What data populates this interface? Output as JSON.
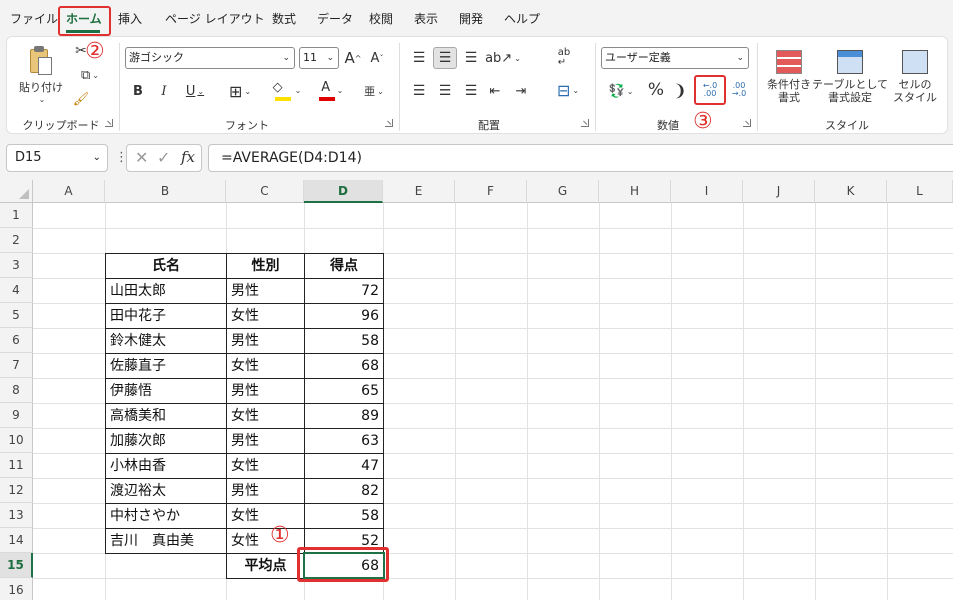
{
  "menu": {
    "tabs": [
      "ファイル",
      "ホーム",
      "挿入",
      "ページ レイアウト",
      "数式",
      "データ",
      "校閲",
      "表示",
      "開発",
      "ヘルプ"
    ],
    "active_tab": "ホーム"
  },
  "ribbon": {
    "clipboard": {
      "paste_label": "貼り付け",
      "group_label": "クリップボード"
    },
    "font": {
      "font_name": "游ゴシック",
      "font_size": "11",
      "group_label": "フォント",
      "grow_label": "A",
      "shrink_label": "A",
      "bold": "B",
      "italic": "I",
      "underline": "U",
      "font_color_letter": "A",
      "phonetic_label": "亜",
      "fill_color": "#ffe000",
      "font_color": "#e00000"
    },
    "alignment": {
      "group_label": "配置"
    },
    "number": {
      "format": "ユーザー定義",
      "group_label": "数値",
      "percent": "%",
      "comma": "❩",
      "increase_decimal": ".00",
      "decrease_decimal": ".00"
    },
    "styles": {
      "conditional_label": "条件付き\n書式",
      "table_label": "テーブルとして\n書式設定",
      "cell_style_label": "セルの\nスタイル",
      "group_label": "スタイル"
    },
    "markers": {
      "one": "①",
      "two": "②",
      "three": "③"
    }
  },
  "formula_bar": {
    "name_box": "D15",
    "fx": "fx",
    "formula": "=AVERAGE(D4:D14)"
  },
  "sheet": {
    "columns": [
      "A",
      "B",
      "C",
      "D",
      "E",
      "F",
      "G",
      "H",
      "I",
      "J",
      "K",
      "L"
    ],
    "rows": [
      "1",
      "2",
      "3",
      "4",
      "5",
      "6",
      "7",
      "8",
      "9",
      "10",
      "11",
      "12",
      "13",
      "14",
      "15",
      "16"
    ],
    "selected_column": "D",
    "selected_row": "15",
    "table": {
      "headers": [
        "氏名",
        "性別",
        "得点"
      ],
      "rows": [
        {
          "name": "山田太郎",
          "gender": "男性",
          "score": "72"
        },
        {
          "name": "田中花子",
          "gender": "女性",
          "score": "96"
        },
        {
          "name": "鈴木健太",
          "gender": "男性",
          "score": "58"
        },
        {
          "name": "佐藤直子",
          "gender": "女性",
          "score": "68"
        },
        {
          "name": "伊藤悟",
          "gender": "男性",
          "score": "65"
        },
        {
          "name": "高橋美和",
          "gender": "女性",
          "score": "89"
        },
        {
          "name": "加藤次郎",
          "gender": "男性",
          "score": "63"
        },
        {
          "name": "小林由香",
          "gender": "女性",
          "score": "47"
        },
        {
          "name": "渡辺裕太",
          "gender": "男性",
          "score": "82"
        },
        {
          "name": "中村さやか",
          "gender": "女性",
          "score": "58"
        },
        {
          "name": "吉川　真由美",
          "gender": "女性",
          "score": "52"
        }
      ],
      "average_label": "平均点",
      "average_value": "68"
    }
  }
}
